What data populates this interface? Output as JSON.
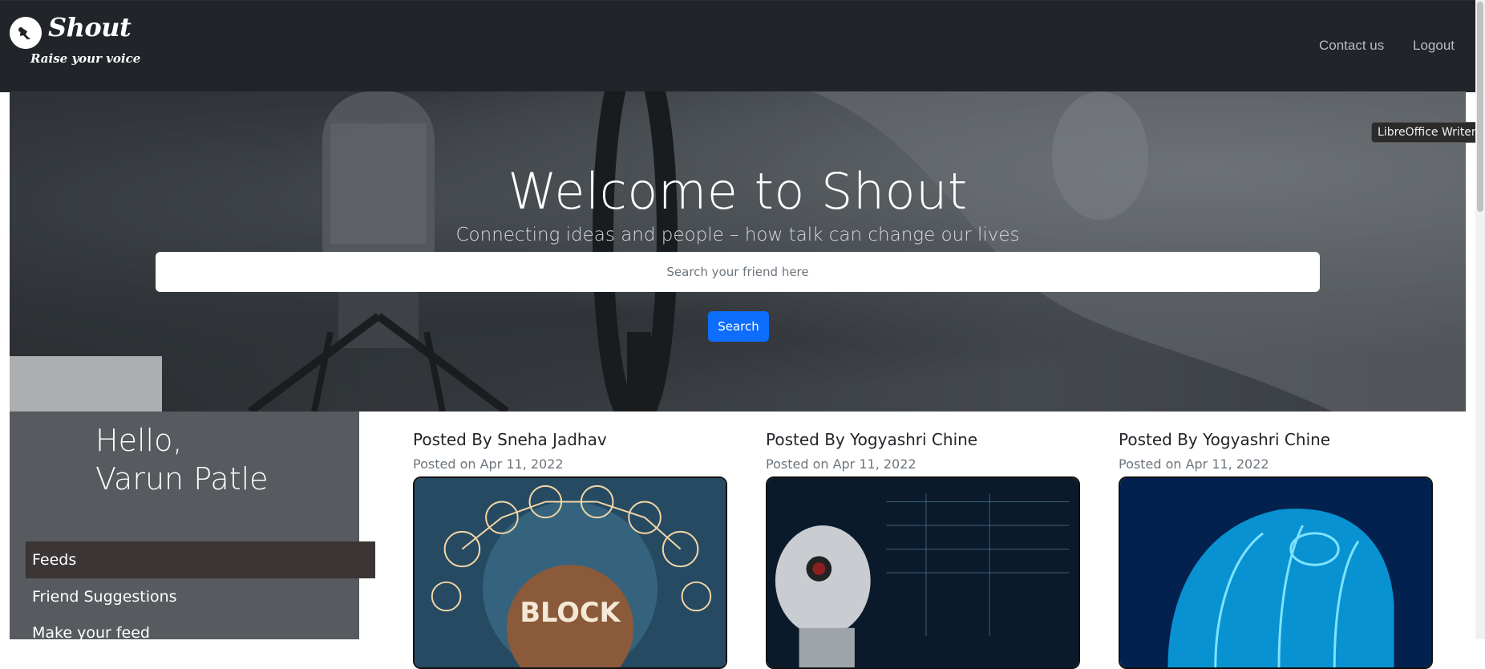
{
  "navbar": {
    "brand": "Shout",
    "tagline": "Raise your voice",
    "links": [
      "Contact us",
      "Logout"
    ]
  },
  "hero": {
    "title": "Welcome to Shout",
    "subtitle": "Connecting ideas and people – how talk can change our lives",
    "search_placeholder": "Search your friend here",
    "search_button": "Search"
  },
  "tooltip": "LibreOffice Writer",
  "sidebar": {
    "greeting_line1": "Hello,",
    "greeting_line2": "Varun Patle",
    "items": [
      {
        "label": "Feeds",
        "active": true
      },
      {
        "label": "Friend Suggestions",
        "active": false
      },
      {
        "label": "Make your feed",
        "active": false
      }
    ]
  },
  "posts": [
    {
      "author": "Posted By Sneha Jadhav",
      "date": "Posted on Apr 11, 2022",
      "image_text": "BLOCK"
    },
    {
      "author": "Posted By Yogyashri Chine",
      "date": "Posted on Apr 11, 2022"
    },
    {
      "author": "Posted By Yogyashri Chine",
      "date": "Posted on Apr 11, 2022"
    }
  ],
  "colors": {
    "navbar": "#212529",
    "primary": "#0d6efd",
    "sidebar": "#575a5f",
    "sidebar_active": "#3b3535"
  }
}
